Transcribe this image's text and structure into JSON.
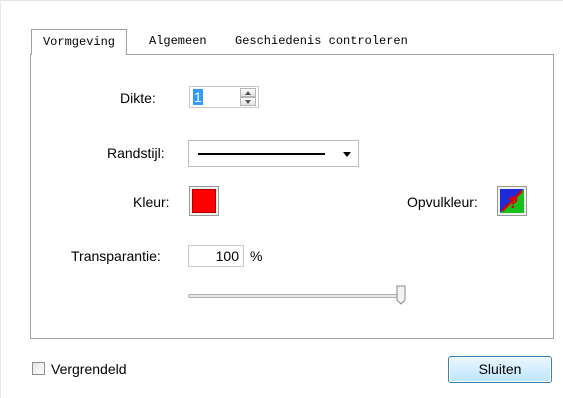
{
  "tabs": [
    {
      "label": "Vormgeving",
      "active": true
    },
    {
      "label": "Algemeen",
      "active": false
    },
    {
      "label": "Geschiedenis controleren",
      "active": false
    }
  ],
  "form": {
    "thickness_label": "Dikte:",
    "thickness_value": "1",
    "border_style_label": "Randstijl:",
    "border_style_value": "solid-line",
    "color_label": "Kleur:",
    "color_value": "#ff0000",
    "fill_color_label": "Opvulkleur:",
    "fill_color_value": "none",
    "transparency_label": "Transparantie:",
    "transparency_value": "100",
    "transparency_unit": "%",
    "opacity_slider_fraction": 1.0
  },
  "footer": {
    "lock_label": "Vergrendeld",
    "lock_checked": false,
    "close_label": "Sluiten"
  },
  "colors": {
    "accent_button_border": "#3c7fb1",
    "selection": "#3399ff"
  }
}
